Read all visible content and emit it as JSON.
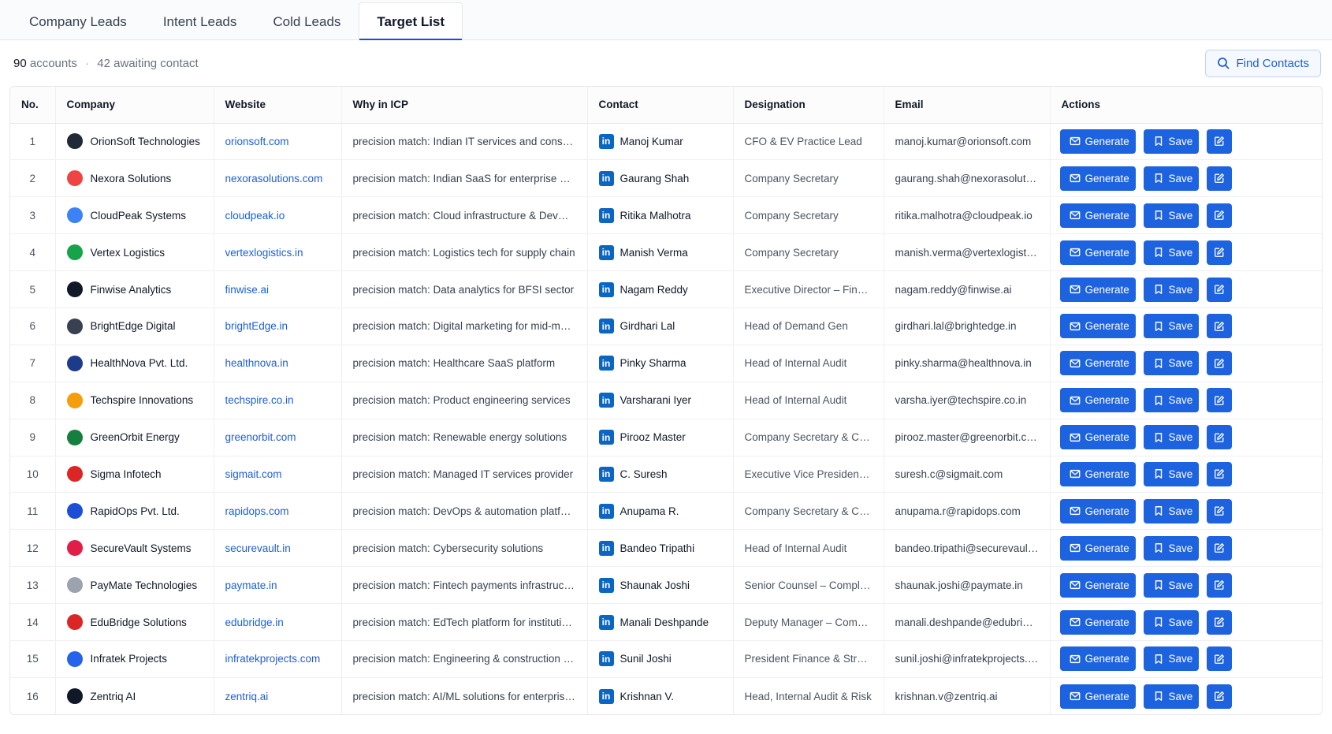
{
  "tabs": [
    {
      "label": "Company Leads",
      "active": false
    },
    {
      "label": "Intent Leads",
      "active": false
    },
    {
      "label": "Cold Leads",
      "active": false
    },
    {
      "label": "Target List",
      "active": true
    }
  ],
  "summary": {
    "accounts_count": "90",
    "accounts_label": "accounts",
    "separator": "·",
    "awaiting": "42 awaiting contact"
  },
  "find_contacts_label": "Find Contacts",
  "columns": {
    "no": "No.",
    "company": "Company",
    "website": "Website",
    "why": "Why in ICP",
    "contact": "Contact",
    "designation": "Designation",
    "email": "Email",
    "actions": "Actions"
  },
  "actions": {
    "generate": "Generate",
    "save": "Save"
  },
  "linkedin_glyph": "in",
  "rows": [
    {
      "no": "1",
      "company": "OrionSoft Technologies",
      "logo_color": "#1f2937",
      "website": "orionsoft.com",
      "why": "precision match: Indian IT services and consulting",
      "contact": "Manoj Kumar",
      "designation": "CFO & EV Practice Lead",
      "email": "manoj.kumar@orionsoft.com"
    },
    {
      "no": "2",
      "company": "Nexora Solutions",
      "logo_color": "#ef4444",
      "website": "nexorasolutions.com",
      "why": "precision match: Indian SaaS for enterprise ops",
      "contact": "Gaurang Shah",
      "designation": "Company Secretary",
      "email": "gaurang.shah@nexorasolutions.com"
    },
    {
      "no": "3",
      "company": "CloudPeak Systems",
      "logo_color": "#3b82f6",
      "website": "cloudpeak.io",
      "why": "precision match: Cloud infrastructure & DevOps tools",
      "contact": "Ritika Malhotra",
      "designation": "Company Secretary",
      "email": "ritika.malhotra@cloudpeak.io"
    },
    {
      "no": "4",
      "company": "Vertex Logistics",
      "logo_color": "#16a34a",
      "website": "vertexlogistics.in",
      "why": "precision match: Logistics tech for supply chain",
      "contact": "Manish Verma",
      "designation": "Company Secretary",
      "email": "manish.verma@vertexlogistics.in"
    },
    {
      "no": "5",
      "company": "Finwise Analytics",
      "logo_color": "#111827",
      "website": "finwise.ai",
      "why": "precision match: Data analytics for BFSI sector",
      "contact": "Nagam Reddy",
      "designation": "Executive Director – Finance",
      "email": "nagam.reddy@finwise.ai"
    },
    {
      "no": "6",
      "company": "BrightEdge Digital",
      "logo_color": "#374151",
      "website": "brightEdge.in",
      "why": "precision match: Digital marketing for mid-market",
      "contact": "Girdhari Lal",
      "designation": "Head of Demand Gen",
      "email": "girdhari.lal@brightedge.in"
    },
    {
      "no": "7",
      "company": "HealthNova Pvt. Ltd.",
      "logo_color": "#1e3a8a",
      "website": "healthnova.in",
      "why": "precision match: Healthcare SaaS platform",
      "contact": "Pinky Sharma",
      "designation": "Head of Internal Audit",
      "email": "pinky.sharma@healthnova.in"
    },
    {
      "no": "8",
      "company": "Techspire Innovations",
      "logo_color": "#f59e0b",
      "website": "techspire.co.in",
      "why": "precision match: Product engineering services",
      "contact": "Varsharani Iyer",
      "designation": "Head of Internal Audit",
      "email": "varsha.iyer@techspire.co.in"
    },
    {
      "no": "9",
      "company": "GreenOrbit Energy",
      "logo_color": "#15803d",
      "website": "greenorbit.com",
      "why": "precision match: Renewable energy solutions",
      "contact": "Pirooz Master",
      "designation": "Company Secretary & Compliance",
      "email": "pirooz.master@greenorbit.com"
    },
    {
      "no": "10",
      "company": "Sigma Infotech",
      "logo_color": "#dc2626",
      "website": "sigmait.com",
      "why": "precision match: Managed IT services provider",
      "contact": "C. Suresh",
      "designation": "Executive Vice President – IT",
      "email": "suresh.c@sigmait.com"
    },
    {
      "no": "11",
      "company": "RapidOps Pvt. Ltd.",
      "logo_color": "#1d4ed8",
      "website": "rapidops.com",
      "why": "precision match: DevOps & automation platform",
      "contact": "Anupama R.",
      "designation": "Company Secretary & Compliance",
      "email": "anupama.r@rapidops.com"
    },
    {
      "no": "12",
      "company": "SecureVault Systems",
      "logo_color": "#e11d48",
      "website": "securevault.in",
      "why": "precision match: Cybersecurity solutions",
      "contact": "Bandeo Tripathi",
      "designation": "Head of Internal Audit",
      "email": "bandeo.tripathi@securevault.in"
    },
    {
      "no": "13",
      "company": "PayMate Technologies",
      "logo_color": "#9ca3af",
      "website": "paymate.in",
      "why": "precision match: Fintech payments infrastructure",
      "contact": "Shaunak Joshi",
      "designation": "Senior Counsel – Compliance",
      "email": "shaunak.joshi@paymate.in"
    },
    {
      "no": "14",
      "company": "EduBridge Solutions",
      "logo_color": "#dc2626",
      "website": "edubridge.in",
      "why": "precision match: EdTech platform for institutions",
      "contact": "Manali Deshpande",
      "designation": "Deputy Manager – Compliance",
      "email": "manali.deshpande@edubridge.in"
    },
    {
      "no": "15",
      "company": "Infratek Projects",
      "logo_color": "#2563eb",
      "website": "infratekprojects.com",
      "why": "precision match: Engineering & construction tech",
      "contact": "Sunil Joshi",
      "designation": "President Finance & Strategy",
      "email": "sunil.joshi@infratekprojects.com"
    },
    {
      "no": "16",
      "company": "Zentriq AI",
      "logo_color": "#111827",
      "website": "zentriq.ai",
      "why": "precision match: AI/ML solutions for enterprises",
      "contact": "Krishnan V.",
      "designation": "Head, Internal Audit & Risk",
      "email": "krishnan.v@zentriq.ai"
    }
  ]
}
